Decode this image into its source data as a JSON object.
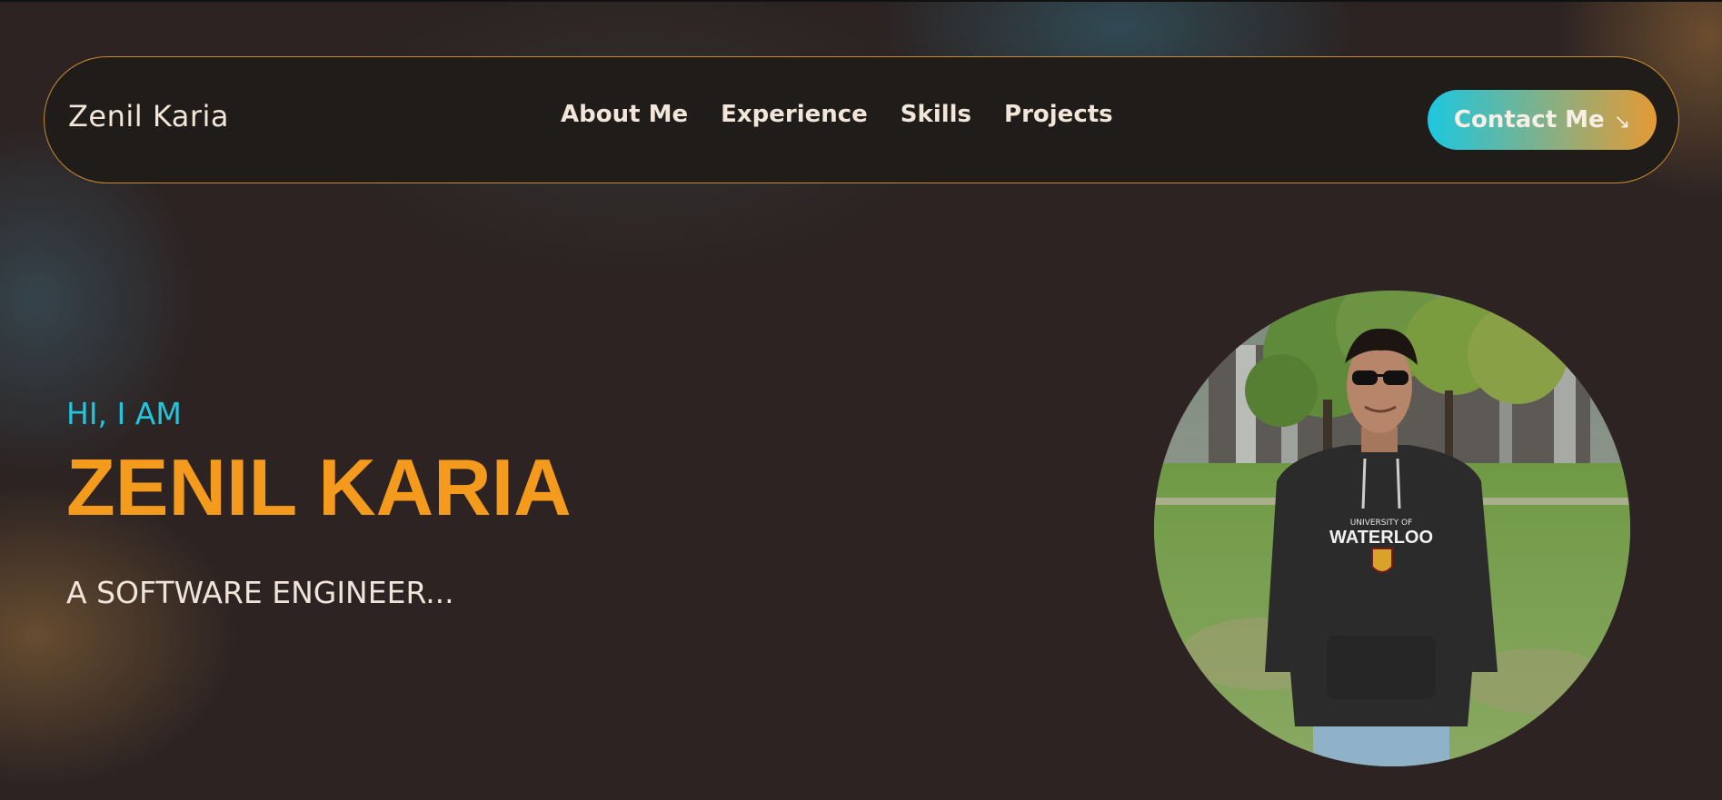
{
  "header": {
    "logo": "Zenil Karia",
    "nav": [
      {
        "label": "About Me"
      },
      {
        "label": "Experience"
      },
      {
        "label": "Skills"
      },
      {
        "label": "Projects"
      }
    ],
    "contact": {
      "label": "Contact Me",
      "icon": "arrow-down-right-icon",
      "arrow": "↘"
    }
  },
  "hero": {
    "greeting": "HI, I AM",
    "name": "ZENIL KARIA",
    "role": "A SOFTWARE ENGINEER..."
  },
  "photo": {
    "hoodie_text_top": "UNIVERSITY OF",
    "hoodie_text_main": "WATERLOO"
  },
  "colors": {
    "accent_cyan": "#21c6de",
    "accent_orange": "#f49a1d",
    "background": "#2c2322",
    "nav_border": "#c98a2e"
  }
}
